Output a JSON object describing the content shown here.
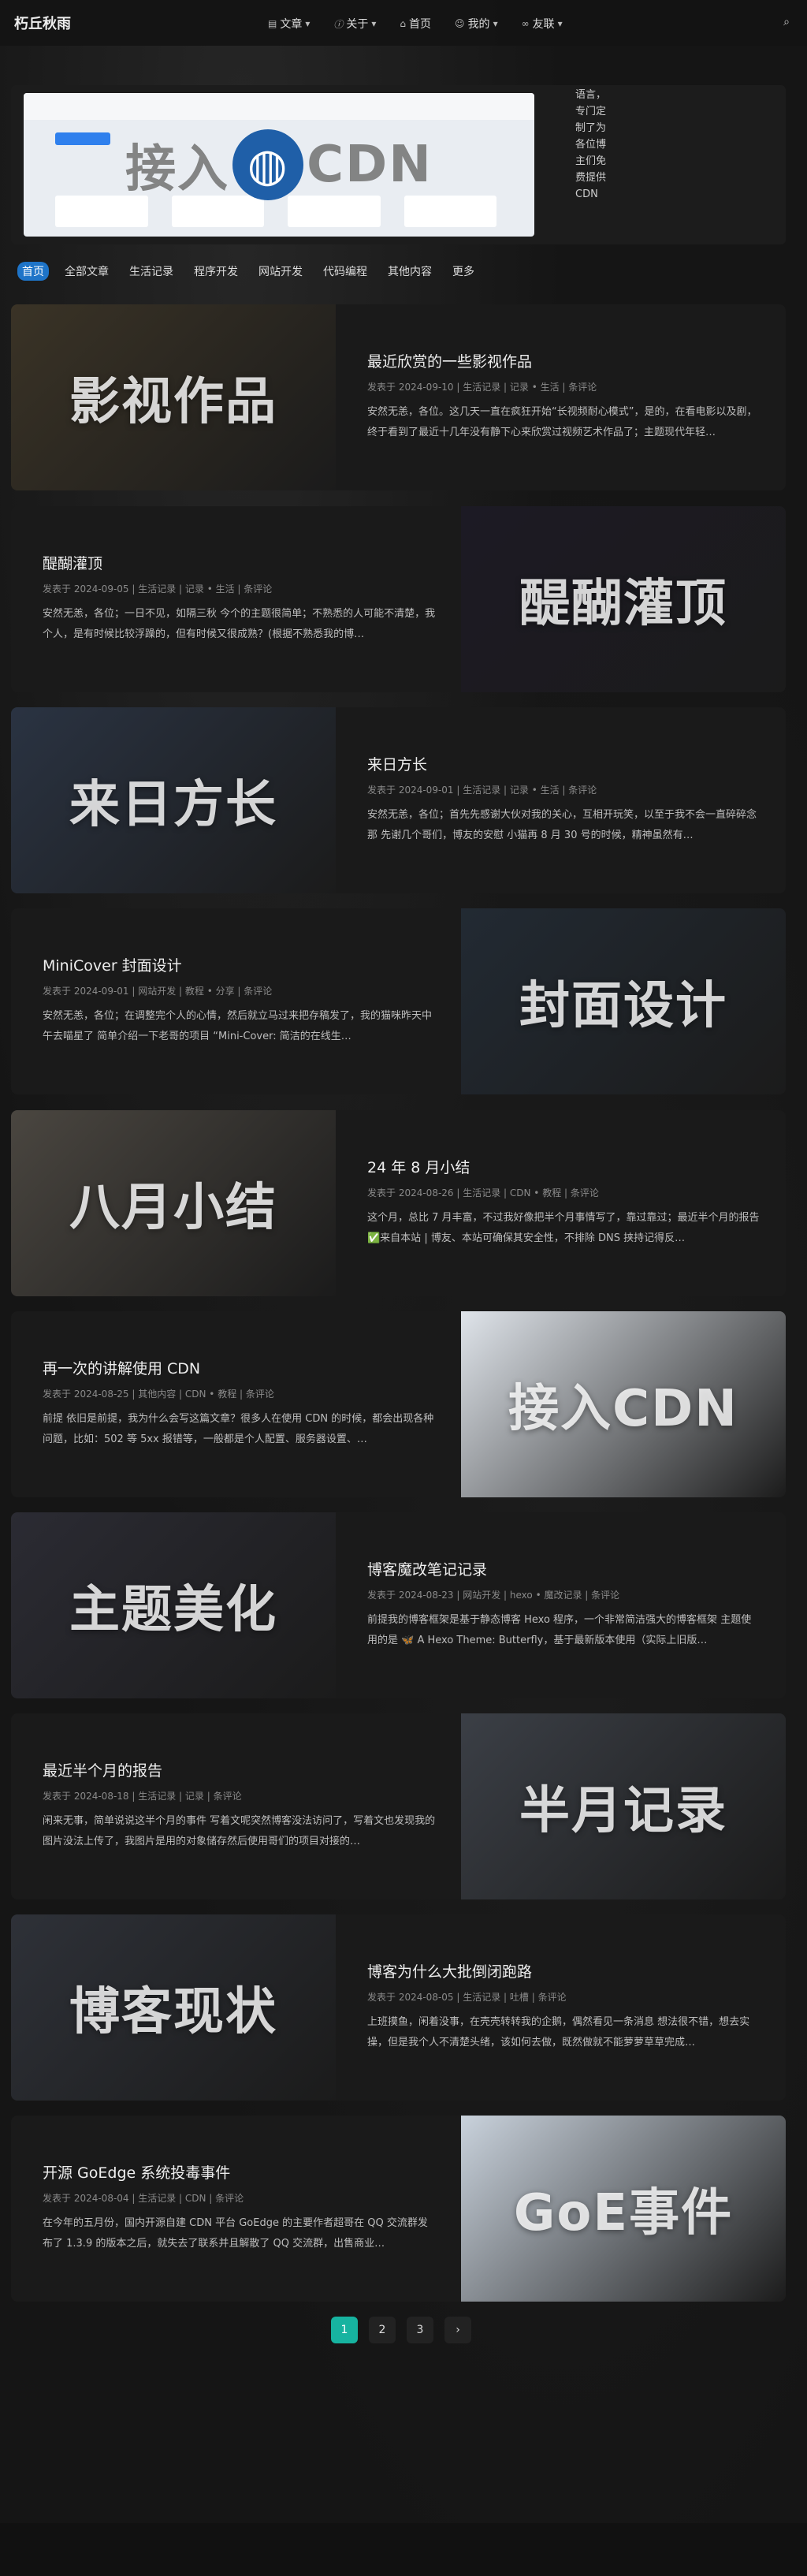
{
  "site": {
    "brand": "朽丘秋雨"
  },
  "nav": {
    "items": [
      {
        "label": "文章",
        "icon": "article-icon"
      },
      {
        "label": "关于",
        "icon": "info-icon"
      },
      {
        "label": "首页",
        "icon": "home-icon"
      },
      {
        "label": "我的",
        "icon": "user-icon"
      },
      {
        "label": "友联",
        "icon": "link-icon"
      }
    ],
    "search_icon": "search-icon"
  },
  "hero": {
    "cover_text_left": "接入",
    "cover_text_right": "CDN",
    "side_text": "语言，专门定制了为各位博主们免费提供CDN"
  },
  "categories": [
    "首页",
    "全部文章",
    "生活记录",
    "程序开发",
    "网站开发",
    "代码编程",
    "其他内容",
    "更多"
  ],
  "posts": [
    {
      "title": "最近欣赏的一些影视作品",
      "cover": "影视作品",
      "date": "2024-09-10",
      "meta": "发表于 2024-09-10 | 生活记录 | 记录 • 生活 | 条评论",
      "excerpt": "安然无恙，各位。这几天一直在疯狂开始“长视频耐心模式”，是的，在看电影以及剧，终于看到了最近十几年没有静下心来欣赏过视频艺术作品了；主题现代年轻…"
    },
    {
      "title": "醍醐灌顶",
      "cover": "醍醐灌顶",
      "meta": "发表于 2024-09-05 | 生活记录 | 记录 • 生活 | 条评论",
      "excerpt": "安然无恙，各位；一日不见，如隔三秋 今个的主题很简单；不熟悉的人可能不清楚，我个人，是有时候比较浮躁的，但有时候又很成熟？(根据不熟悉我的博…"
    },
    {
      "title": "来日方长",
      "cover": "来日方长",
      "meta": "发表于 2024-09-01 | 生活记录 | 记录 • 生活 | 条评论",
      "excerpt": "安然无恙，各位；首先先感谢大伙对我的关心，互相开玩笑，以至于我不会一直碎碎念那 先谢几个哥们，博友的安慰 小猫再 8 月 30 号的时候，精神虽然有…"
    },
    {
      "title": "MiniCover 封面设计",
      "cover": "封面设计",
      "meta": "发表于 2024-09-01 | 网站开发 | 教程 • 分享 | 条评论",
      "excerpt": "安然无恙，各位；在调整完个人的心情，然后就立马过来把存稿发了，我的猫咪昨天中午去喵星了 简单介绍一下老哥的项目 “Mini-Cover: 简洁的在线生…"
    },
    {
      "title": "24 年 8 月小结",
      "cover": "八月小结",
      "meta": "发表于 2024-08-26 | 生活记录 | CDN • 教程 | 条评论",
      "excerpt": "这个月，总比 7 月丰富，不过我好像把半个月事情写了，靠过靠过；最近半个月的报告 ✅来自本站 | 博友、本站可确保其安全性，不排除 DNS 挟持记得反…"
    },
    {
      "title": "再一次的讲解使用 CDN",
      "cover": "接入CDN",
      "meta": "发表于 2024-08-25 | 其他内容 | CDN • 教程 | 条评论",
      "excerpt": "前提 依旧是前提，我为什么会写这篇文章？很多人在使用 CDN 的时候，都会出现各种问题，比如：502 等 5xx 报错等，一般都是个人配置、服务器设置、…"
    },
    {
      "title": "博客魔改笔记记录",
      "cover": "主题美化",
      "meta": "发表于 2024-08-23 | 网站开发 | hexo • 魔改记录 | 条评论",
      "excerpt": "前提我的博客框架是基于静态博客 Hexo 程序，一个非常简洁强大的博客框架 主题使用的是 🦋 A Hexo Theme: Butterfly，基于最新版本使用（实际上旧版…"
    },
    {
      "title": "最近半个月的报告",
      "cover": "半月记录",
      "meta": "发表于 2024-08-18 | 生活记录 | 记录 | 条评论",
      "excerpt": "闲来无事，简单说说这半个月的事件 写着文呢突然博客没法访问了，写着文也发现我的图片没法上传了，我图片是用的对象储存然后使用哥们的项目对接的…"
    },
    {
      "title": "博客为什么大批倒闭跑路",
      "cover": "博客现状",
      "meta": "发表于 2024-08-05 | 生活记录 | 吐槽 | 条评论",
      "excerpt": "上班摸鱼，闲着没事，在壳壳转转我的企鹅，偶然看见一条消息 想法很不错，想去实操，但是我个人不清楚头绪，该如何去做，既然做就不能萝萝草草完成…"
    },
    {
      "title": "开源 GoEdge 系统投毒事件",
      "cover": "GoE事件",
      "meta": "发表于 2024-08-04 | 生活记录 | CDN | 条评论",
      "excerpt": "在今年的五月份，国内开源自建 CDN 平台 GoEdge 的主要作者超哥在 QQ 交流群发布了 1.3.9 的版本之后，就失去了联系并且解散了 QQ 交流群，出售商业…"
    }
  ],
  "pagination": {
    "pages": [
      "1",
      "2",
      "3",
      "›"
    ],
    "current": "1"
  },
  "colors": {
    "accent": "#1e74c8",
    "pager": "#17b3a0",
    "bg": "#141414"
  }
}
